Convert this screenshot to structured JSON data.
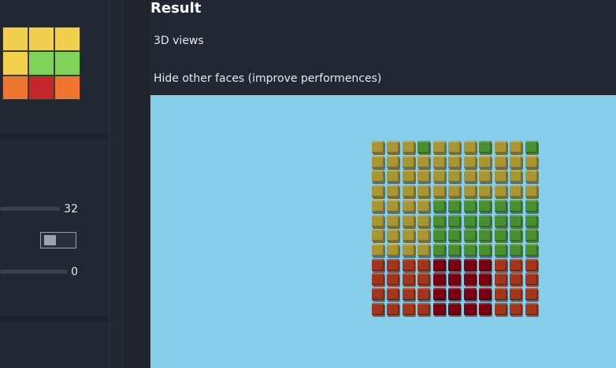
{
  "header": {
    "title": "Result"
  },
  "options": {
    "views_label": "3D views",
    "hide_faces_label": "Hide other faces (improve performences)"
  },
  "controls": {
    "slider1_value": "32",
    "slider2_value": "0",
    "toggle_on": false
  },
  "colors": {
    "yellow": "#f2d04e",
    "green": "#7ed35a",
    "red": "#c4272b",
    "orange": "#f07530",
    "viewport_bg": "#87ceeb",
    "cube_yellow": "#a99632",
    "cube_green": "#488f2e",
    "cube_red": "#7a0010",
    "cube_orange": "#a3361a"
  },
  "palette_rows": [
    [
      "yellow",
      "yellow",
      "yellow"
    ],
    [
      "yellow",
      "green",
      "green"
    ],
    [
      "orange",
      "red",
      "orange"
    ]
  ],
  "cube_rows": [
    "YYYGYYYGYYG",
    "YYYYYYYYYYY",
    "YYYYYYYYYYY",
    "YYYYYYYYYYY",
    "YYYYGGGGGGG",
    "YYYYGGGGGGG",
    "YYYYGGGGGGG",
    "YYYYGGGGGGG",
    "OOOORRRROOO",
    "OOOORRRROOO",
    "OOOORRRROOO",
    "OOOORRRROOO"
  ]
}
